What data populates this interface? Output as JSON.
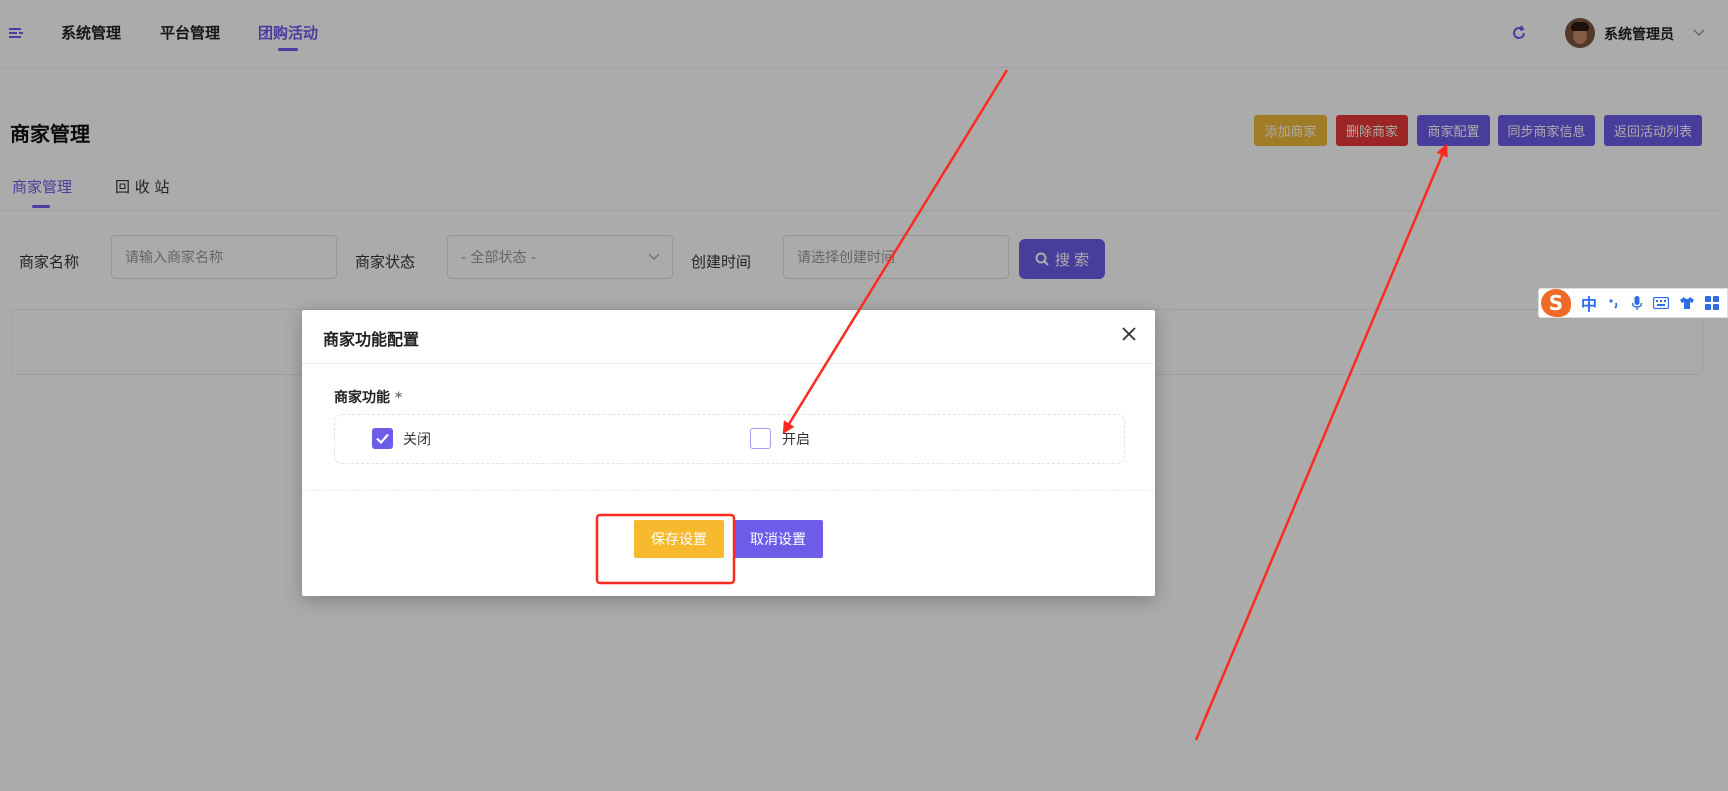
{
  "topnav": {
    "items": [
      {
        "label": "系统管理",
        "active": false
      },
      {
        "label": "平台管理",
        "active": false
      },
      {
        "label": "团购活动",
        "active": true
      }
    ],
    "user_name": "系统管理员"
  },
  "page": {
    "title": "商家管理",
    "actions": {
      "add": "添加商家",
      "delete": "删除商家",
      "config": "商家配置",
      "sync": "同步商家信息",
      "back": "返回活动列表"
    },
    "tabs": [
      {
        "label": "商家管理",
        "active": true
      },
      {
        "label": "回 收 站",
        "active": false
      }
    ],
    "filters": {
      "name_label": "商家名称",
      "name_placeholder": "请输入商家名称",
      "status_label": "商家状态",
      "status_value": "- 全部状态 -",
      "time_label": "创建时间",
      "time_placeholder": "请选择创建时间",
      "search_label": "搜 索"
    }
  },
  "ime": {
    "lang": "中"
  },
  "dialog": {
    "title": "商家功能配置",
    "field_label": "商家功能",
    "required_mark": "*",
    "options": [
      {
        "label": "关闭",
        "checked": true
      },
      {
        "label": "开启",
        "checked": false
      }
    ],
    "save_label": "保存设置",
    "cancel_label": "取消设置"
  },
  "colors": {
    "primary": "#6c5ce7",
    "gold": "#f0b93b",
    "red": "#e93838",
    "annotation": "#ff2a1f"
  }
}
